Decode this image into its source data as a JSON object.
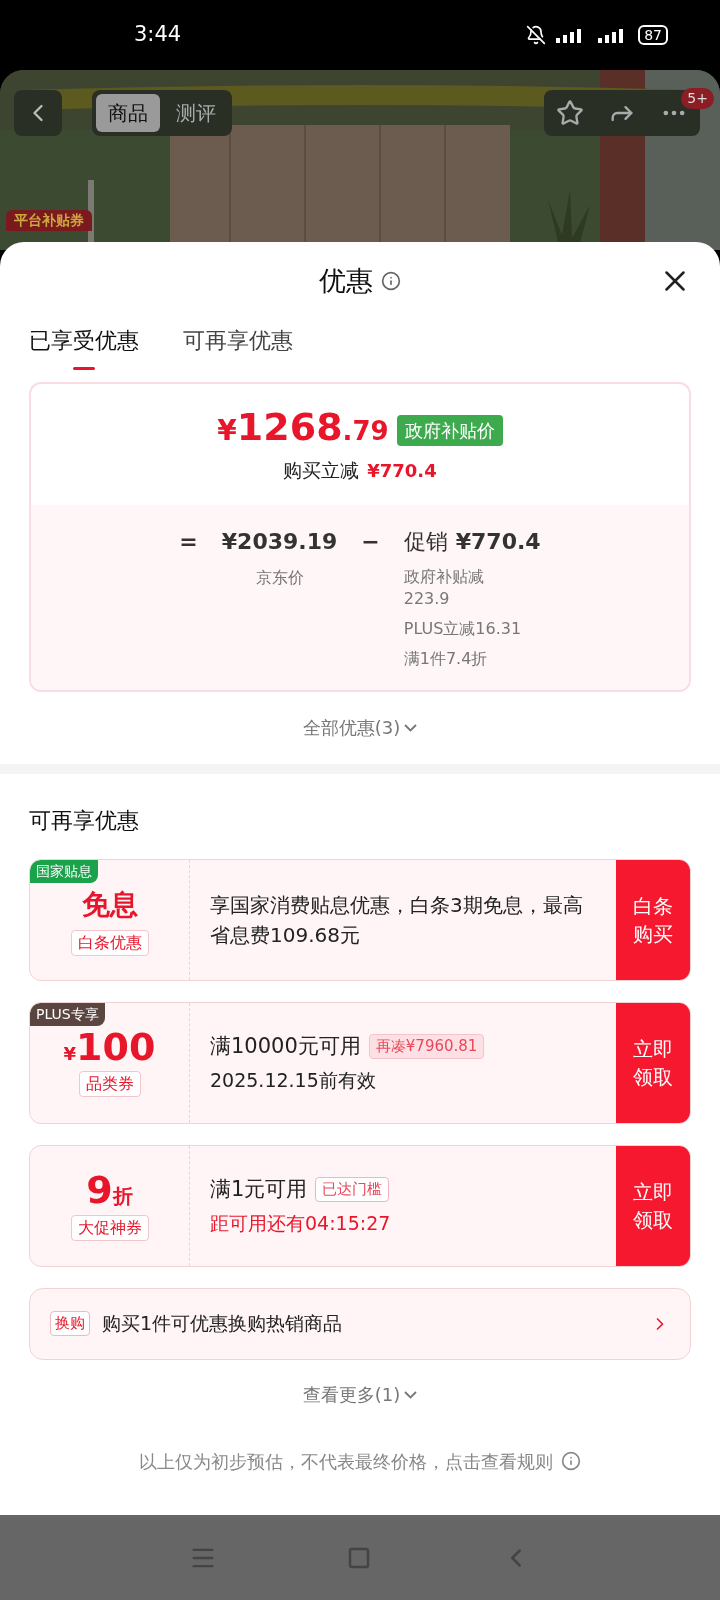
{
  "status_bar": {
    "time": "3:44",
    "battery": "87"
  },
  "product_header": {
    "tabs": [
      {
        "label": "商品",
        "selected": true
      },
      {
        "label": "测评",
        "selected": false
      }
    ],
    "badge": "5+",
    "corner_tag": "平台补贴券"
  },
  "sheet": {
    "title": "优惠",
    "tabs": [
      {
        "label": "已享受优惠",
        "selected": true
      },
      {
        "label": "可再享优惠",
        "selected": false
      }
    ]
  },
  "summary": {
    "currency": "¥",
    "price_integer": "1268",
    "price_decimal": ".79",
    "price_tag": "政府补贴价",
    "saving_label": "购买立减",
    "saving_value": "¥770.4",
    "equals": "=",
    "base_price": "¥2039.19",
    "base_label": "京东价",
    "minus": "−",
    "promo_label": "促销",
    "promo_value": "¥770.4",
    "promo_details": [
      "政府补贴减223.9",
      "PLUS立减16.31",
      "满1件7.4折"
    ],
    "expand": "全部优惠(3)"
  },
  "more_offers": {
    "heading": "可再享优惠",
    "coupons": [
      {
        "kind": "text",
        "corner_tag": {
          "text": "国家贴息",
          "color": "#1aa34a"
        },
        "value": "免息",
        "sub_label": "白条优惠",
        "description": "享国家消费贴息优惠，白条3期免息，最高省息费109.68元",
        "button": "白条购买"
      },
      {
        "kind": "offer",
        "corner_tag": {
          "text": "PLUS专享",
          "color": "#5a4540"
        },
        "prefix": "¥",
        "value": "100",
        "sub_label": "品类券",
        "condition": "满10000元可用",
        "chip": {
          "text": "再凑¥7960.81",
          "kind": "filled"
        },
        "note": {
          "text": "2025.12.15前有效",
          "kind": "date"
        },
        "button": "立即领取"
      },
      {
        "kind": "offer",
        "value": "9",
        "suffix": "折",
        "sub_label": "大促神券",
        "condition": "满1元可用",
        "chip": {
          "text": "已达门槛",
          "kind": "outline"
        },
        "note": {
          "text": "距可用还有04:15:27",
          "kind": "countdown"
        },
        "button": "立即领取"
      }
    ],
    "swap": {
      "tag": "换购",
      "text": "购买1件可优惠换购热销商品"
    },
    "see_more": "查看更多(1)"
  },
  "footnote": "以上仅为初步预估，不代表最终价格，点击查看规则"
}
